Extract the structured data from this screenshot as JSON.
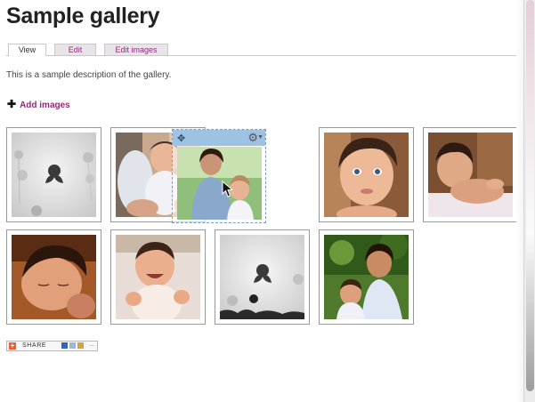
{
  "page": {
    "title": "Sample gallery"
  },
  "tabs": [
    {
      "label": "View",
      "active": true
    },
    {
      "label": "Edit",
      "active": false
    },
    {
      "label": "Edit images",
      "active": false
    }
  ],
  "description": "This is a sample description of the gallery.",
  "actions": {
    "add_images_label": "Add images",
    "add_icon": "plus-icon"
  },
  "gallery": {
    "images": [
      {
        "name": "placeholder-image",
        "kind": "placeholder"
      },
      {
        "name": "baby-on-lap-photo",
        "kind": "photo"
      },
      {
        "name": "dragged-photo",
        "kind": "photo",
        "dragging": true
      },
      {
        "name": "baby-closeup-photo",
        "kind": "photo"
      },
      {
        "name": "baby-lying-photo",
        "kind": "photo"
      },
      {
        "name": "baby-sleeping-photo",
        "kind": "photo"
      },
      {
        "name": "baby-smiling-photo",
        "kind": "photo"
      },
      {
        "name": "placeholder-image-2",
        "kind": "placeholder"
      },
      {
        "name": "mother-and-baby-photo",
        "kind": "photo"
      }
    ],
    "drag_toolbar_icons": [
      "move-icon",
      "gear-icon",
      "chevron-down-icon"
    ]
  },
  "share": {
    "label": "SHARE",
    "more": "..."
  },
  "colors": {
    "link": "#8d2d78",
    "drag_bar": "#9dc2e4",
    "share_accent": "#f25c2a"
  }
}
